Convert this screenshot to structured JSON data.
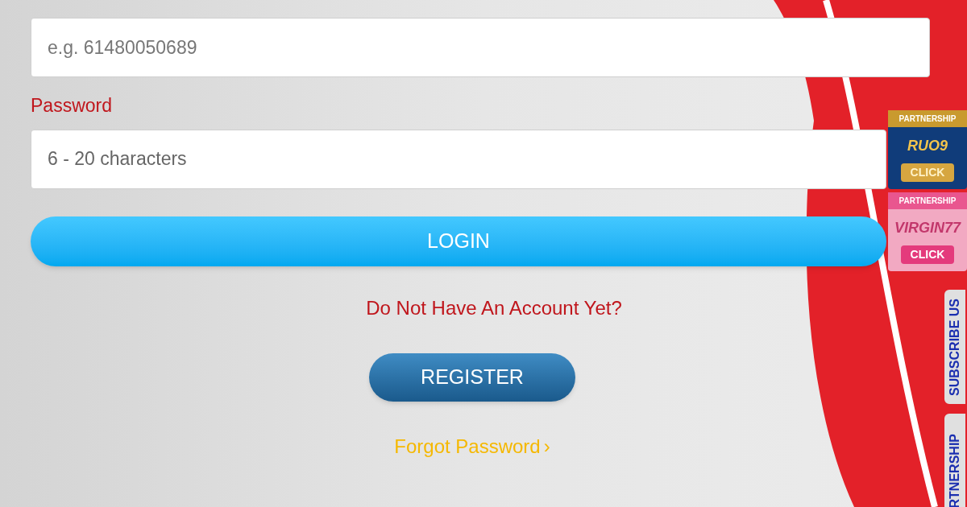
{
  "login_form": {
    "phone_field": {
      "placeholder": "e.g. 61480050689"
    },
    "password_label": "Password",
    "password_field": {
      "placeholder": "6 - 20 characters"
    },
    "login_button": "LOGIN",
    "no_account_text": "Do Not Have An Account Yet?",
    "register_button": "REGISTER",
    "forgot_password_link": "Forgot Password",
    "forgot_password_chevron": "›"
  },
  "side_banners": [
    {
      "header": "PARTNERSHIP",
      "brand": "RUO9",
      "action": "CLICK",
      "kind": "blue"
    },
    {
      "header": "PARTNERSHIP",
      "brand": "VIRGIN77",
      "action": "CLICK",
      "kind": "pink"
    }
  ],
  "side_tabs": [
    "SUBSCRIBE US",
    "RTNERSHIP"
  ]
}
